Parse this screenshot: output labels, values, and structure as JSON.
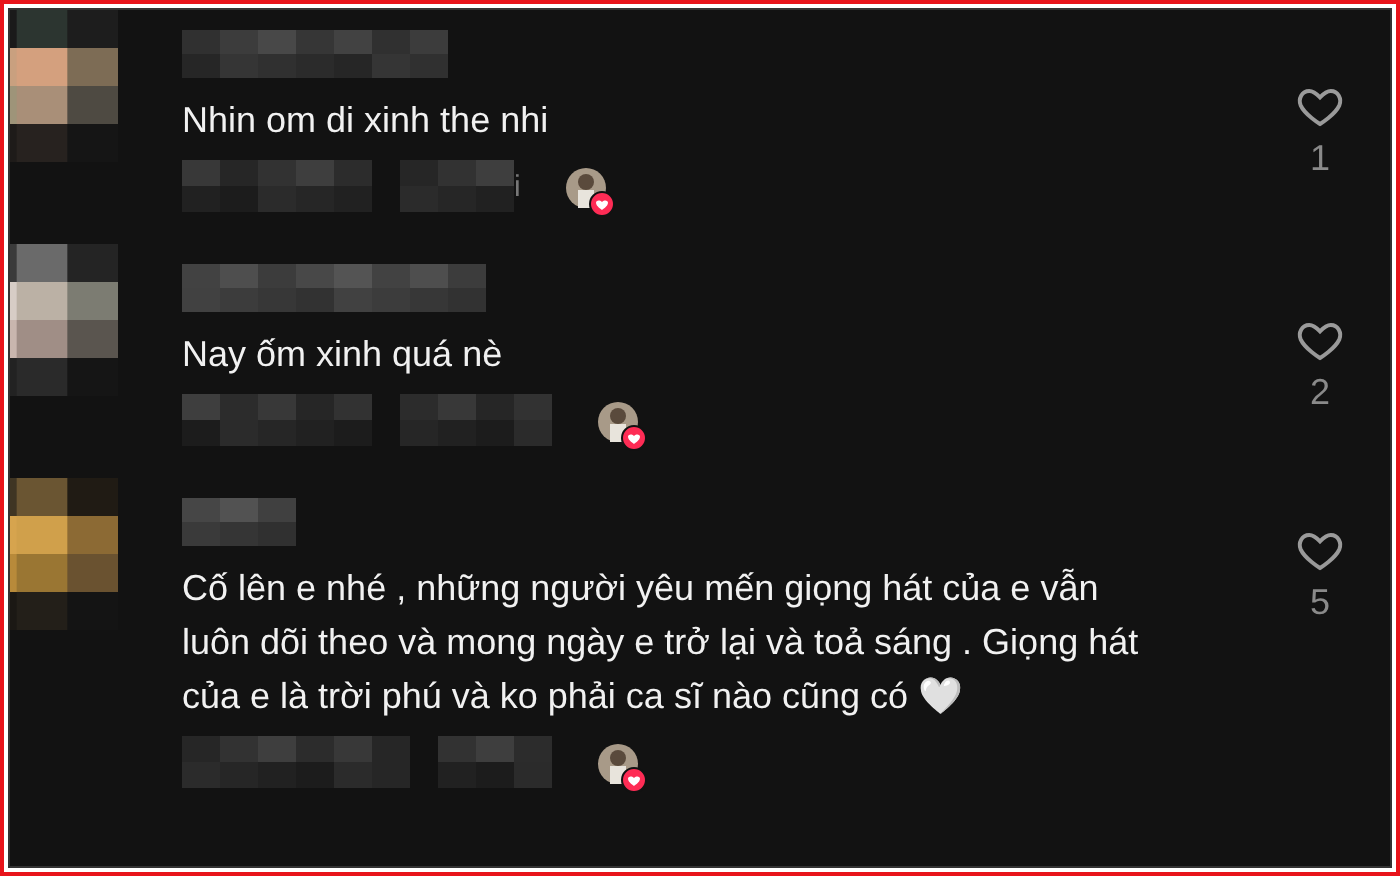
{
  "comments": [
    {
      "text": "Nhin om di xinh the nhi",
      "meta_fragment": "i",
      "creator_liked": true,
      "liked": false,
      "likes": "1"
    },
    {
      "text": "Nay ốm xinh quá nè",
      "creator_liked": true,
      "liked": false,
      "likes": "2"
    },
    {
      "text": "Cố lên e nhé , những người yêu mến giọng hát của e vẫn luôn dõi theo và mong ngày e trở lại và toả sáng . Giọng hát của e là trời phú và ko phải ca sĩ nào cũng có 🤍",
      "creator_liked": true,
      "liked": false,
      "likes": "5"
    }
  ]
}
